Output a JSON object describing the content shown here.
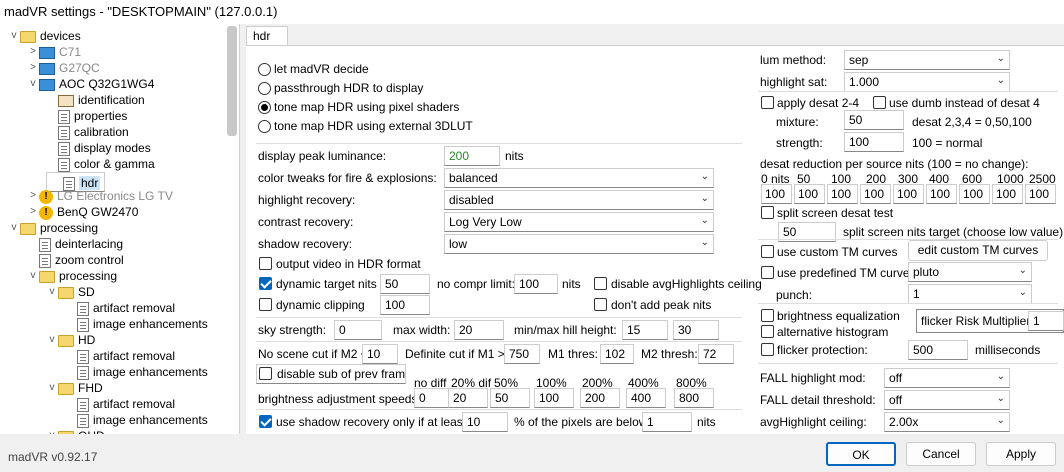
{
  "window": {
    "title": "madVR settings - \"DESKTOPMAIN\" (127.0.0.1)"
  },
  "tree": {
    "items": [
      {
        "label": "devices",
        "level": 0,
        "icon": "folder",
        "exp": "v"
      },
      {
        "label": "C71",
        "level": 1,
        "icon": "monitor",
        "exp": ">",
        "grey": true
      },
      {
        "label": "G27QC",
        "level": 1,
        "icon": "monitor",
        "exp": ">",
        "grey": true
      },
      {
        "label": "AOC Q32G1WG4",
        "level": 1,
        "icon": "monitor",
        "exp": "v"
      },
      {
        "label": "identification",
        "level": 2,
        "icon": "id"
      },
      {
        "label": "properties",
        "level": 2,
        "icon": "page"
      },
      {
        "label": "calibration",
        "level": 2,
        "icon": "page"
      },
      {
        "label": "display modes",
        "level": 2,
        "icon": "page"
      },
      {
        "label": "color & gamma",
        "level": 2,
        "icon": "page"
      },
      {
        "label": "hdr",
        "level": 2,
        "icon": "page",
        "selected": true
      },
      {
        "label": "LG Electronics LG TV",
        "level": 1,
        "icon": "warn",
        "exp": ">",
        "grey": true
      },
      {
        "label": "BenQ GW2470",
        "level": 1,
        "icon": "warn",
        "exp": ">"
      },
      {
        "label": "processing",
        "level": 0,
        "icon": "folder",
        "exp": "v"
      },
      {
        "label": "deinterlacing",
        "level": 1,
        "icon": "page"
      },
      {
        "label": "zoom control",
        "level": 1,
        "icon": "page"
      },
      {
        "label": "processing",
        "level": 1,
        "icon": "folder",
        "exp": "v"
      },
      {
        "label": "SD",
        "level": 2,
        "icon": "folder",
        "exp": "v"
      },
      {
        "label": "artifact removal",
        "level": 3,
        "icon": "page"
      },
      {
        "label": "image enhancements",
        "level": 3,
        "icon": "page"
      },
      {
        "label": "HD",
        "level": 2,
        "icon": "folder",
        "exp": "v"
      },
      {
        "label": "artifact removal",
        "level": 3,
        "icon": "page"
      },
      {
        "label": "image enhancements",
        "level": 3,
        "icon": "page"
      },
      {
        "label": "FHD",
        "level": 2,
        "icon": "folder",
        "exp": "v"
      },
      {
        "label": "artifact removal",
        "level": 3,
        "icon": "page"
      },
      {
        "label": "image enhancements",
        "level": 3,
        "icon": "page"
      },
      {
        "label": "QHD",
        "level": 2,
        "icon": "folder",
        "exp": "v"
      }
    ]
  },
  "tab": {
    "label": "hdr"
  },
  "radios": [
    {
      "label": "let madVR decide",
      "checked": false
    },
    {
      "label": "passthrough HDR to display",
      "checked": false
    },
    {
      "label": "tone map HDR using pixel shaders",
      "checked": true
    },
    {
      "label": "tone map HDR using external 3DLUT",
      "checked": false
    }
  ],
  "left": {
    "peak_label": "display peak luminance:",
    "peak_value": "200",
    "peak_unit": "nits",
    "color_tweaks_label": "color tweaks for fire & explosions:",
    "color_tweaks_value": "balanced",
    "highlight_recovery_label": "highlight recovery:",
    "highlight_recovery_value": "disabled",
    "contrast_recovery_label": "contrast recovery:",
    "contrast_recovery_value": "Log Very Low",
    "shadow_recovery_label": "shadow recovery:",
    "shadow_recovery_value": "low",
    "output_video_label": "output video in HDR format",
    "dynamic_target_label": "dynamic target nits",
    "dynamic_target_value": "50",
    "no_compr_label": "no compr limit:",
    "no_compr_value": "100",
    "no_compr_unit": "nits",
    "disable_avg_label": "disable avgHighlights ceiling",
    "dynamic_clipping_label": "dynamic clipping",
    "dynamic_clipping_value": "100",
    "dont_add_peak_label": "don't add peak nits",
    "sky_strength_label": "sky strength:",
    "sky_strength_value": "0",
    "max_width_label": "max width:",
    "max_width_value": "20",
    "minmax_hill_label": "min/max hill height:",
    "minmax_hill_min": "15",
    "minmax_hill_max": "30",
    "no_scene_cut_label": "No scene cut if M2 <",
    "no_scene_cut_value": "10",
    "definite_cut_label": "Definite cut if M1 >",
    "definite_cut_value": "750",
    "m1_thres_label": "M1 thres:",
    "m1_thres_value": "102",
    "m2_thresh_label": "M2 thresh:",
    "m2_thresh_value": "72",
    "disable_sub_label": "disable sub of prev frame",
    "speed_headers": [
      "no diff",
      "20% dif",
      "50%",
      "100%",
      "200%",
      "400%",
      "800%"
    ],
    "speeds_label": "brightness adjustment speeds:",
    "speed_values": [
      "0",
      "20",
      "50",
      "100",
      "200",
      "400",
      "800"
    ],
    "shadow_only_label": "use shadow recovery only if at least:",
    "shadow_only_value": "10",
    "shadow_only_mid": "% of the pixels are below",
    "shadow_only_nits": "1",
    "shadow_only_unit": "nits"
  },
  "right": {
    "lum_method_label": "lum method:",
    "lum_method_value": "sep",
    "highlight_sat_label": "highlight sat:",
    "highlight_sat_value": "1.000",
    "apply_desat_label": "apply desat 2-4",
    "use_dumb_label": "use dumb instead of desat 4",
    "mixture_label": "mixture:",
    "mixture_value": "50",
    "mixture_note": "desat 2,3,4 = 0,50,100",
    "strength_label": "strength:",
    "strength_value": "100",
    "strength_note": "100 = normal",
    "desat_reduction_label": "desat reduction per source nits (100 = no change):",
    "nits_headers": [
      "0 nits",
      "50",
      "100",
      "200",
      "300",
      "400",
      "600",
      "1000",
      "2500"
    ],
    "nits_values": [
      "100",
      "100",
      "100",
      "100",
      "100",
      "100",
      "100",
      "100",
      "100"
    ],
    "split_screen_label": "split screen desat test",
    "split_nits_value": "50",
    "split_nits_label": "split screen nits target (choose low value)",
    "custom_tm_label": "use custom TM curves",
    "edit_custom_label": "edit custom TM curves",
    "predefined_tm_label": "use predefined TM curve",
    "predefined_tm_value": "pluto",
    "punch_label": "punch:",
    "punch_value": "1",
    "brightness_eq_label": "brightness equalization",
    "alt_histogram_label": "alternative histogram",
    "flicker_risk_label": "flicker Risk Multiplier:",
    "flicker_risk_value": "1",
    "flicker_protection_label": "flicker protection:",
    "flicker_protection_value": "500",
    "flicker_protection_unit": "milliseconds",
    "fall_highlight_label": "FALL highlight mod:",
    "fall_highlight_value": "off",
    "fall_detail_label": "FALL detail threshold:",
    "fall_detail_value": "off",
    "avg_ceiling_label": "avgHighlight ceiling:",
    "avg_ceiling_value": "2.00x"
  },
  "checks": {
    "output_video": false,
    "dynamic_target": true,
    "disable_avg": false,
    "dynamic_clipping": false,
    "dont_add_peak": false,
    "disable_sub": false,
    "shadow_only": true,
    "apply_desat": false,
    "use_dumb": false,
    "split_screen": false,
    "custom_tm": false,
    "predefined_tm": false,
    "brightness_eq": false,
    "alt_histogram": false,
    "flicker_protection": false
  },
  "buttons": {
    "ok": "OK",
    "cancel": "Cancel",
    "apply": "Apply"
  },
  "status": {
    "version": "madVR v0.92.17"
  }
}
